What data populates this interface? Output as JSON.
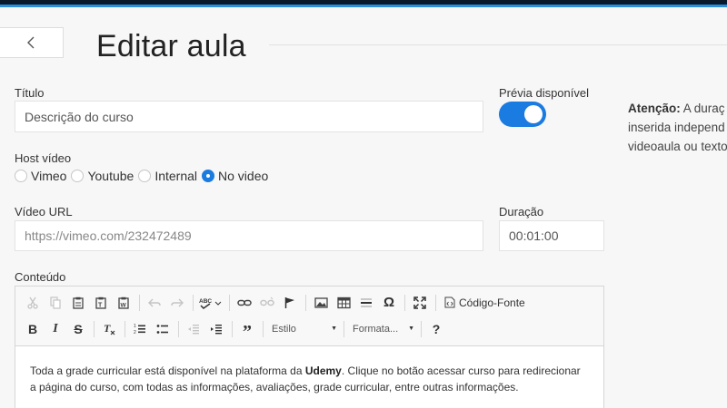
{
  "header": {
    "title": "Editar aula"
  },
  "form": {
    "titulo_label": "Título",
    "titulo_value": "Descrição do curso",
    "previa_label": "Prévia disponível",
    "previa_enabled": true,
    "host_label": "Host vídeo",
    "host_options": [
      "Vimeo",
      "Youtube",
      "Internal",
      "No video"
    ],
    "host_selected": "No video",
    "video_url_label": "Vídeo URL",
    "video_url_placeholder": "https://vimeo.com/232472489",
    "duracao_label": "Duração",
    "duracao_value": "00:01:00",
    "conteudo_label": "Conteúdo"
  },
  "note": {
    "bold": "Atenção:",
    "line1_rest": " A duraç",
    "line2": "inserida independ",
    "line3": "videoaula ou texto"
  },
  "editor": {
    "toolbar": {
      "source_label": "Código-Fonte",
      "estilo_label": "Estilo",
      "formata_label": "Formata...",
      "help_label": "?"
    },
    "content": {
      "part1": "Toda a grade curricular está disponível na plataforma da ",
      "bold": "Udemy",
      "part2": ". Clique no botão acessar curso para redirecionar a página do curso, com todas as informações, avaliações, grade curricular, entre outras informações."
    }
  },
  "colors": {
    "accent": "#1a7be0",
    "topbar": "#0a1a2a",
    "topbar_border": "#2b8fd9"
  }
}
